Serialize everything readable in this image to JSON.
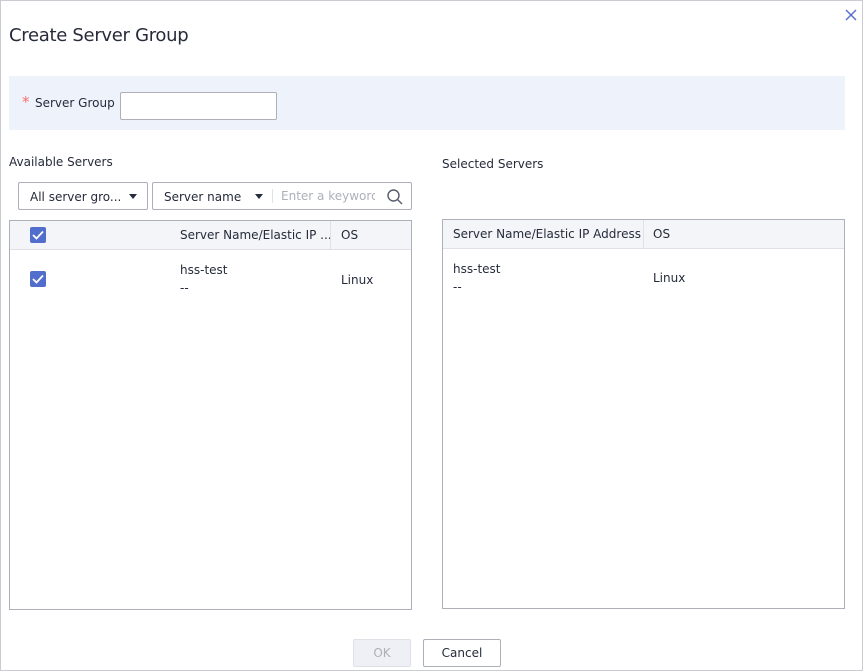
{
  "dialog": {
    "title": "Create Server Group",
    "close_icon": "close-icon"
  },
  "form": {
    "required_mark": "*",
    "server_group_label": "Server Group",
    "server_group_value": ""
  },
  "available": {
    "label": "Available Servers",
    "group_filter": "All server gro...",
    "search_field": "Server name",
    "search_placeholder": "Enter a keyword",
    "search_icon": "search-icon",
    "columns": [
      "Server Name/Elastic IP ...",
      "OS"
    ],
    "rows": [
      {
        "checked": true,
        "name": "hss-test",
        "ip": "--",
        "os": "Linux"
      }
    ],
    "select_all_checked": true
  },
  "selected": {
    "label": "Selected Servers",
    "columns": [
      "Server Name/Elastic IP Address",
      "OS"
    ],
    "rows": [
      {
        "name": "hss-test",
        "ip": "--",
        "os": "Linux"
      }
    ]
  },
  "footer": {
    "ok_label": "OK",
    "cancel_label": "Cancel"
  },
  "colors": {
    "accent": "#526ecc",
    "required": "#f66f6a",
    "band": "#eef2fb"
  }
}
